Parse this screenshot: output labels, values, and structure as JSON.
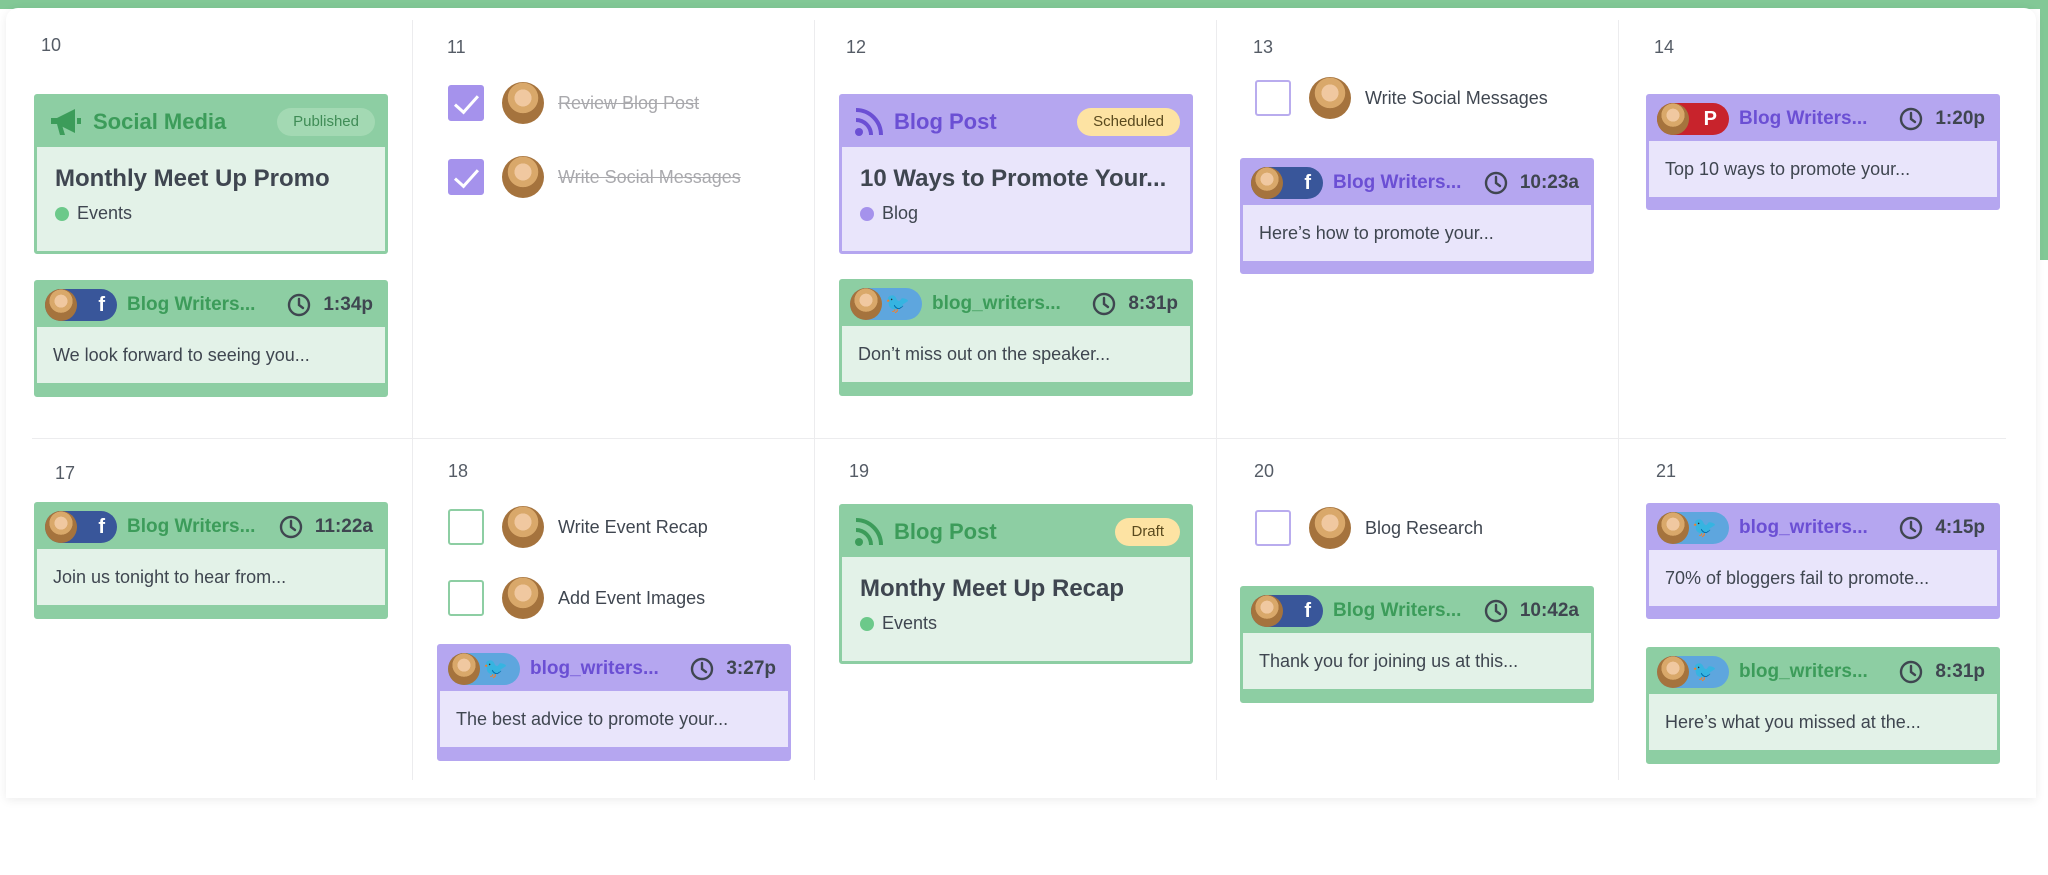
{
  "colors": {
    "green": "#8dcea3",
    "purple": "#b5a6f0",
    "facebook": "#39569a",
    "twitter": "#5ea6de",
    "pinterest": "#c8232c"
  },
  "days": [
    "10",
    "11",
    "12",
    "13",
    "14",
    "17",
    "18",
    "19",
    "20",
    "21"
  ],
  "projects": {
    "p10": {
      "type": "Social Media",
      "icon": "megaphone-icon",
      "status": "Published",
      "title": "Monthly Meet Up Promo",
      "tag": "Events"
    },
    "p12": {
      "type": "Blog Post",
      "icon": "rss-icon",
      "status": "Scheduled",
      "title": "10 Ways to Promote Your...",
      "tag": "Blog"
    },
    "p19": {
      "type": "Blog Post",
      "icon": "rss-icon",
      "status": "Draft",
      "title": "Monthy Meet Up Recap",
      "tag": "Events"
    }
  },
  "social": {
    "s10": {
      "network": "facebook",
      "account": "Blog Writers...",
      "time": "1:34p",
      "message": "We look forward to seeing you..."
    },
    "s12": {
      "network": "twitter",
      "account": "blog_writers...",
      "time": "8:31p",
      "message": "Don’t miss out on the speaker..."
    },
    "s13": {
      "network": "facebook",
      "account": "Blog Writers...",
      "time": "10:23a",
      "message": "Here’s how to promote your..."
    },
    "s14": {
      "network": "pinterest",
      "account": "Blog Writers...",
      "time": "1:20p",
      "message": "Top 10 ways to promote your..."
    },
    "s17": {
      "network": "facebook",
      "account": "Blog Writers...",
      "time": "11:22a",
      "message": "Join us tonight to hear from..."
    },
    "s18": {
      "network": "twitter",
      "account": "blog_writers...",
      "time": "3:27p",
      "message": "The best advice to promote your..."
    },
    "s20": {
      "network": "facebook",
      "account": "Blog Writers...",
      "time": "10:42a",
      "message": "Thank you for joining us at this..."
    },
    "s21a": {
      "network": "twitter",
      "account": "blog_writers...",
      "time": "4:15p",
      "message": "70% of bloggers fail to promote..."
    },
    "s21b": {
      "network": "twitter",
      "account": "blog_writers...",
      "time": "8:31p",
      "message": "Here’s what you missed at the..."
    }
  },
  "tasks": {
    "t11a": {
      "label": "Review Blog Post",
      "done": true
    },
    "t11b": {
      "label": "Write Social Messages",
      "done": true
    },
    "t13": {
      "label": "Write Social Messages",
      "done": false
    },
    "t18a": {
      "label": "Write Event Recap",
      "done": false
    },
    "t18b": {
      "label": "Add Event Images",
      "done": false
    },
    "t20": {
      "label": "Blog Research",
      "done": false
    }
  }
}
